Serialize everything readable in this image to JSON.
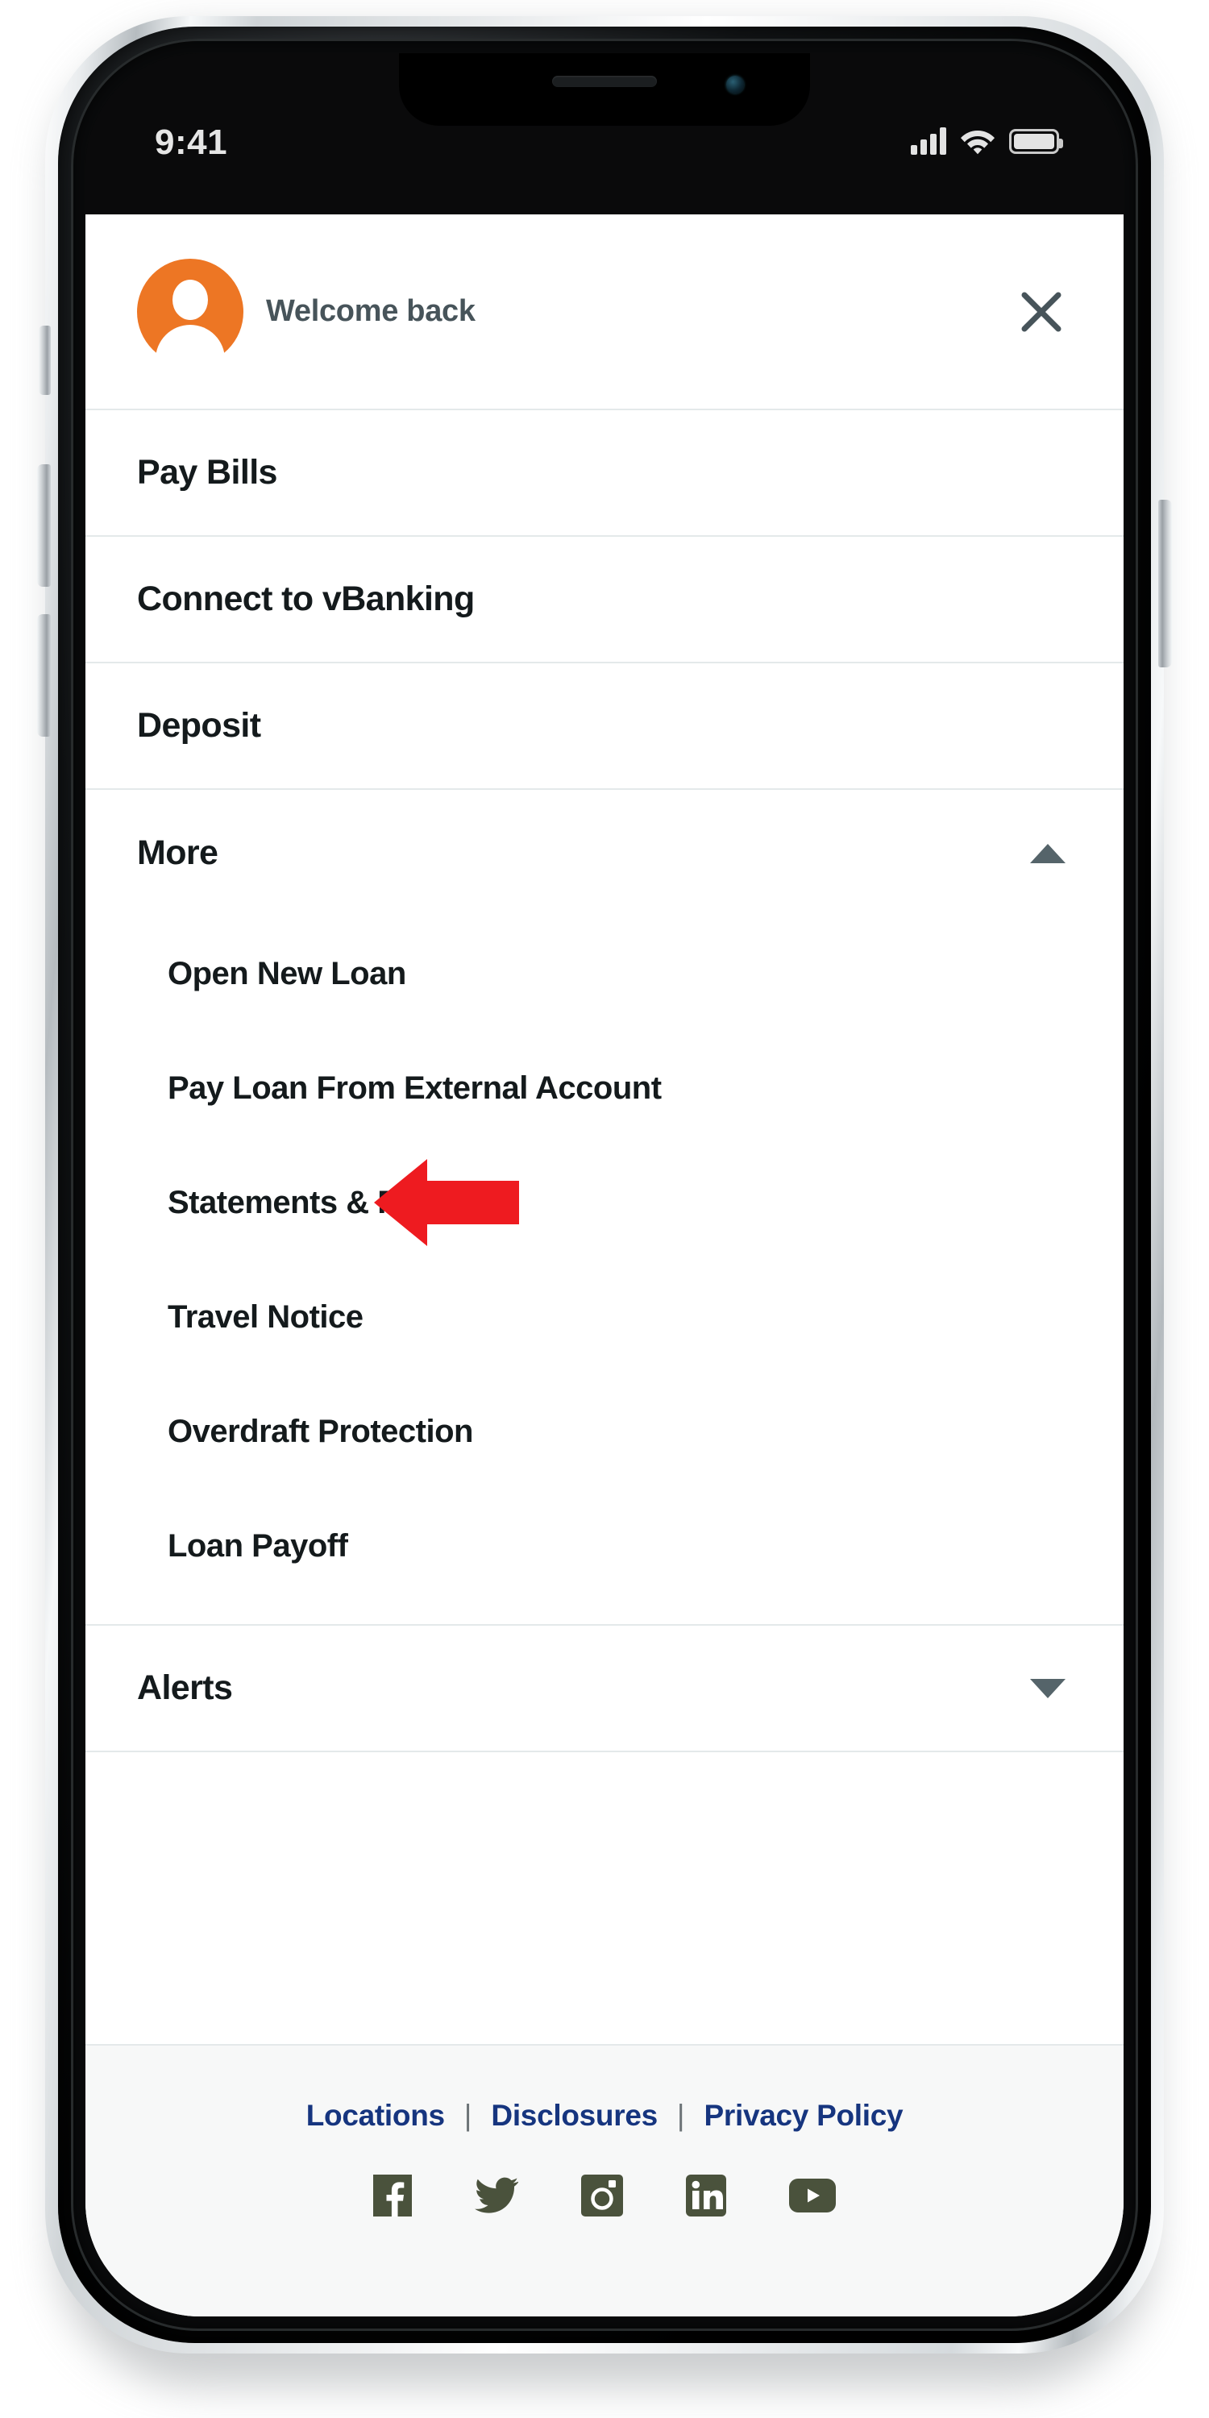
{
  "status_bar": {
    "time": "9:41",
    "signal_icon": "cellular-signal-icon",
    "wifi_icon": "wifi-icon",
    "battery_icon": "battery-full-icon",
    "signal_bars": 4,
    "battery_level": 100
  },
  "header": {
    "avatar_icon": "user-avatar-icon",
    "avatar_color": "#ED7624",
    "welcome_text": "Welcome back",
    "close_icon": "close-x-icon",
    "close_color": "#47545A"
  },
  "menu": {
    "items": [
      {
        "label": "Pay Bills",
        "expandable": false,
        "expanded": false
      },
      {
        "label": "Connect to vBanking",
        "expandable": false,
        "expanded": false
      },
      {
        "label": "Deposit",
        "expandable": false,
        "expanded": false
      },
      {
        "label": "More",
        "expandable": true,
        "expanded": true,
        "chevron_icon": "chevron-up-icon"
      },
      {
        "label": "Alerts",
        "expandable": true,
        "expanded": false,
        "chevron_icon": "chevron-down-icon"
      }
    ],
    "more_submenu": [
      {
        "label": "Open New Loan",
        "has_caret": false
      },
      {
        "label": "Pay Loan From External Account",
        "has_caret": false
      },
      {
        "label": "Statements & Forms",
        "has_caret": true,
        "caret_icon": "caret-down-icon",
        "highlighted": true
      },
      {
        "label": "Travel Notice",
        "has_caret": false
      },
      {
        "label": "Overdraft Protection",
        "has_caret": false
      },
      {
        "label": "Loan Payoff",
        "has_caret": false
      }
    ]
  },
  "annotation": {
    "arrow_icon": "red-pointer-arrow-left-icon",
    "arrow_color": "#EE1B20",
    "points_at": "Statements & Forms"
  },
  "footer": {
    "links": [
      {
        "label": "Locations"
      },
      {
        "label": "Disclosures"
      },
      {
        "label": "Privacy Policy"
      }
    ],
    "separator": "|",
    "link_color": "#16357F",
    "social": [
      {
        "name": "facebook-icon",
        "label": "Facebook"
      },
      {
        "name": "twitter-icon",
        "label": "Twitter"
      },
      {
        "name": "instagram-icon",
        "label": "Instagram"
      },
      {
        "name": "linkedin-icon",
        "label": "LinkedIn"
      },
      {
        "name": "youtube-icon",
        "label": "YouTube"
      }
    ],
    "social_color": "#4A523C"
  }
}
